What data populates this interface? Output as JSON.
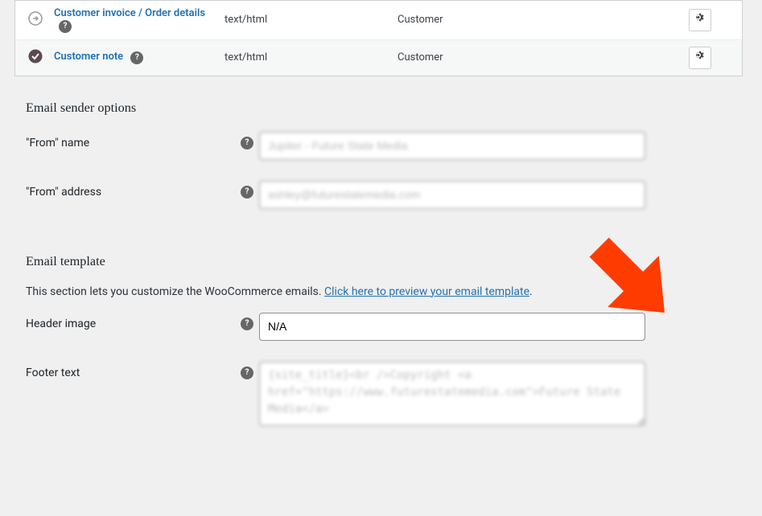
{
  "email_rows": [
    {
      "name": "Customer invoice / Order details",
      "type": "text/html",
      "recipient": "Customer",
      "status": "manual"
    },
    {
      "name": "Customer note",
      "type": "text/html",
      "recipient": "Customer",
      "status": "enabled"
    }
  ],
  "sections": {
    "sender": {
      "title": "Email sender options",
      "from_name_label": "\"From\" name",
      "from_name_value": "Jupiter - Future State Media",
      "from_address_label": "\"From\" address",
      "from_address_value": "ashley@futurestatemedia.com"
    },
    "template": {
      "title": "Email template",
      "description_prefix": "This section lets you customize the WooCommerce emails. ",
      "description_link": "Click here to preview your email template",
      "description_suffix": ".",
      "header_image_label": "Header image",
      "header_image_value": "N/A",
      "footer_text_label": "Footer text",
      "footer_text_value": "{site_title}<br />Copyright <a href=\"https://www.futurestatemedia.com\">Future State Media</a>"
    }
  }
}
